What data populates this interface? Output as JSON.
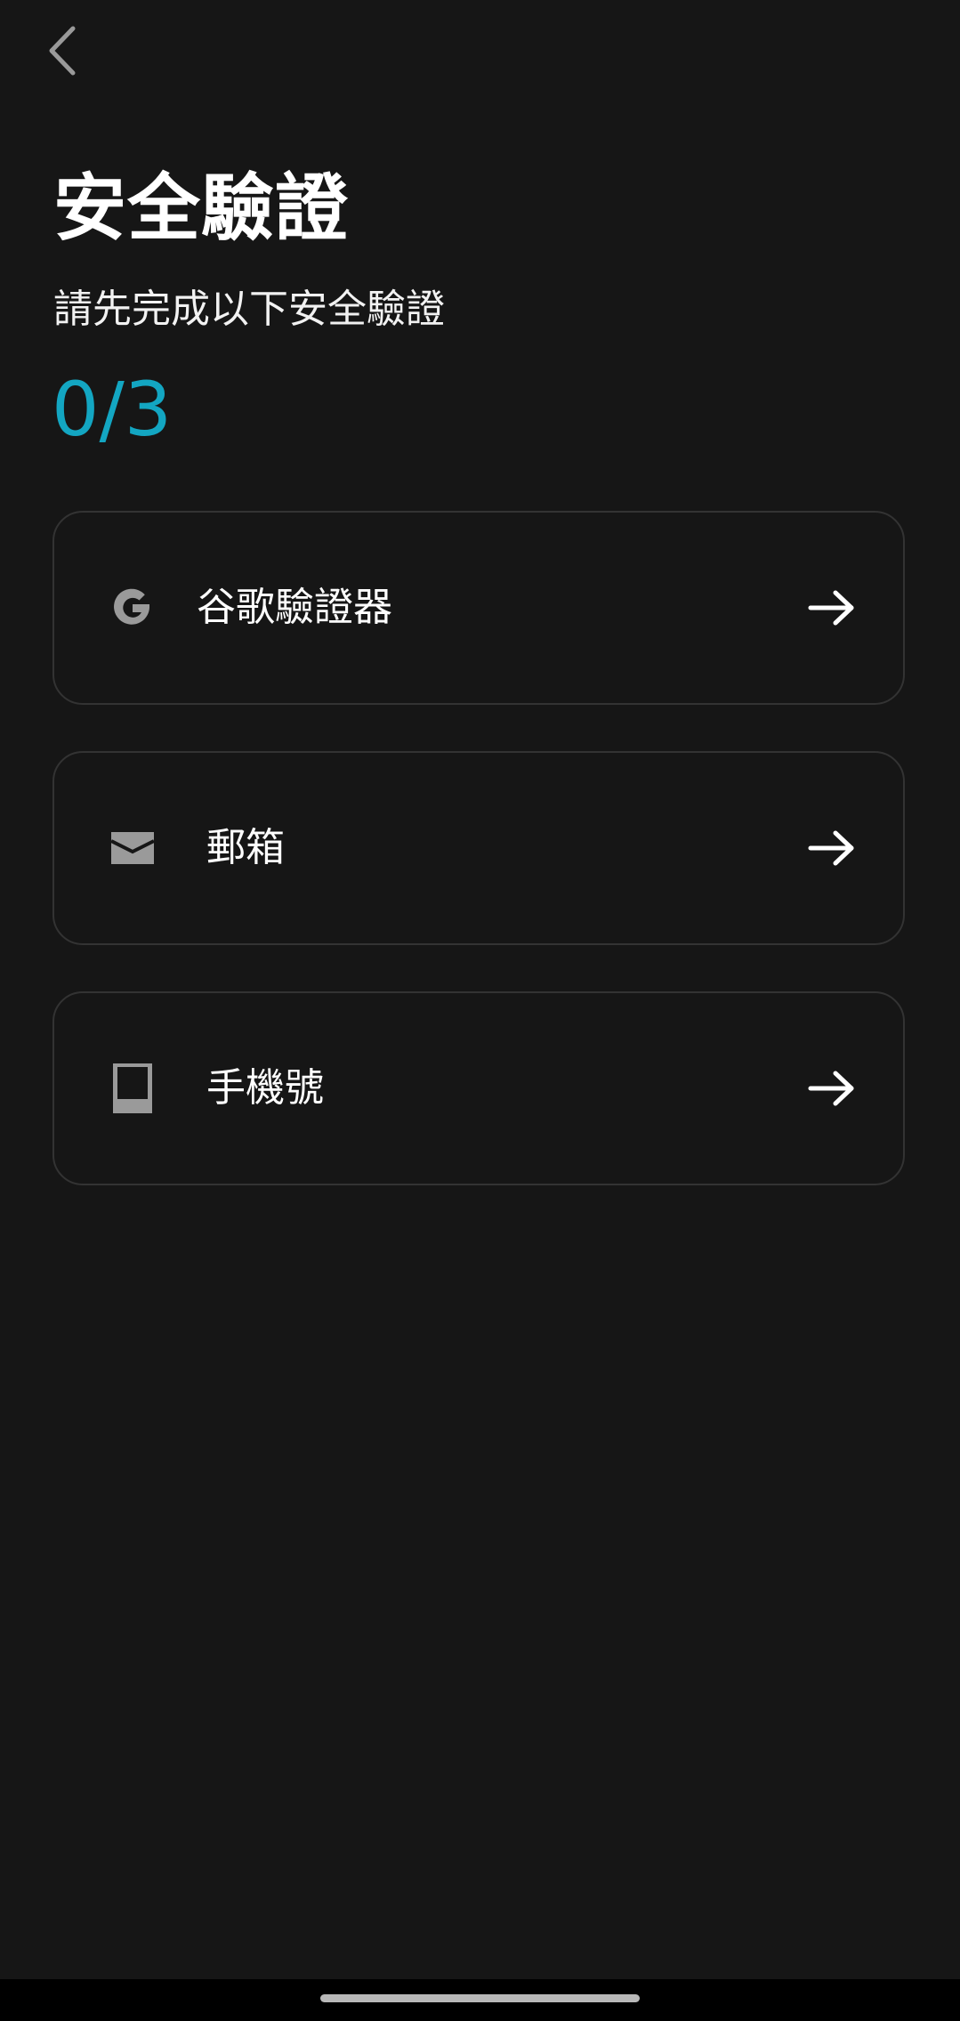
{
  "header": {
    "back_icon": "chevron-left-icon"
  },
  "page": {
    "title": "安全驗證",
    "subtitle": "請先完成以下安全驗證",
    "progress": "0/3",
    "progress_color": "#13a6c2"
  },
  "methods": [
    {
      "label": "谷歌驗證器",
      "icon": "google-icon",
      "arrow": "arrow-right-icon"
    },
    {
      "label": "郵箱",
      "icon": "envelope-icon",
      "arrow": "arrow-right-icon"
    },
    {
      "label": "手機號",
      "icon": "phone-icon",
      "arrow": "arrow-right-icon"
    }
  ],
  "colors": {
    "background": "#161616",
    "card_border": "#333333",
    "icon_gray": "#9a9a9a",
    "text": "#ffffff"
  }
}
